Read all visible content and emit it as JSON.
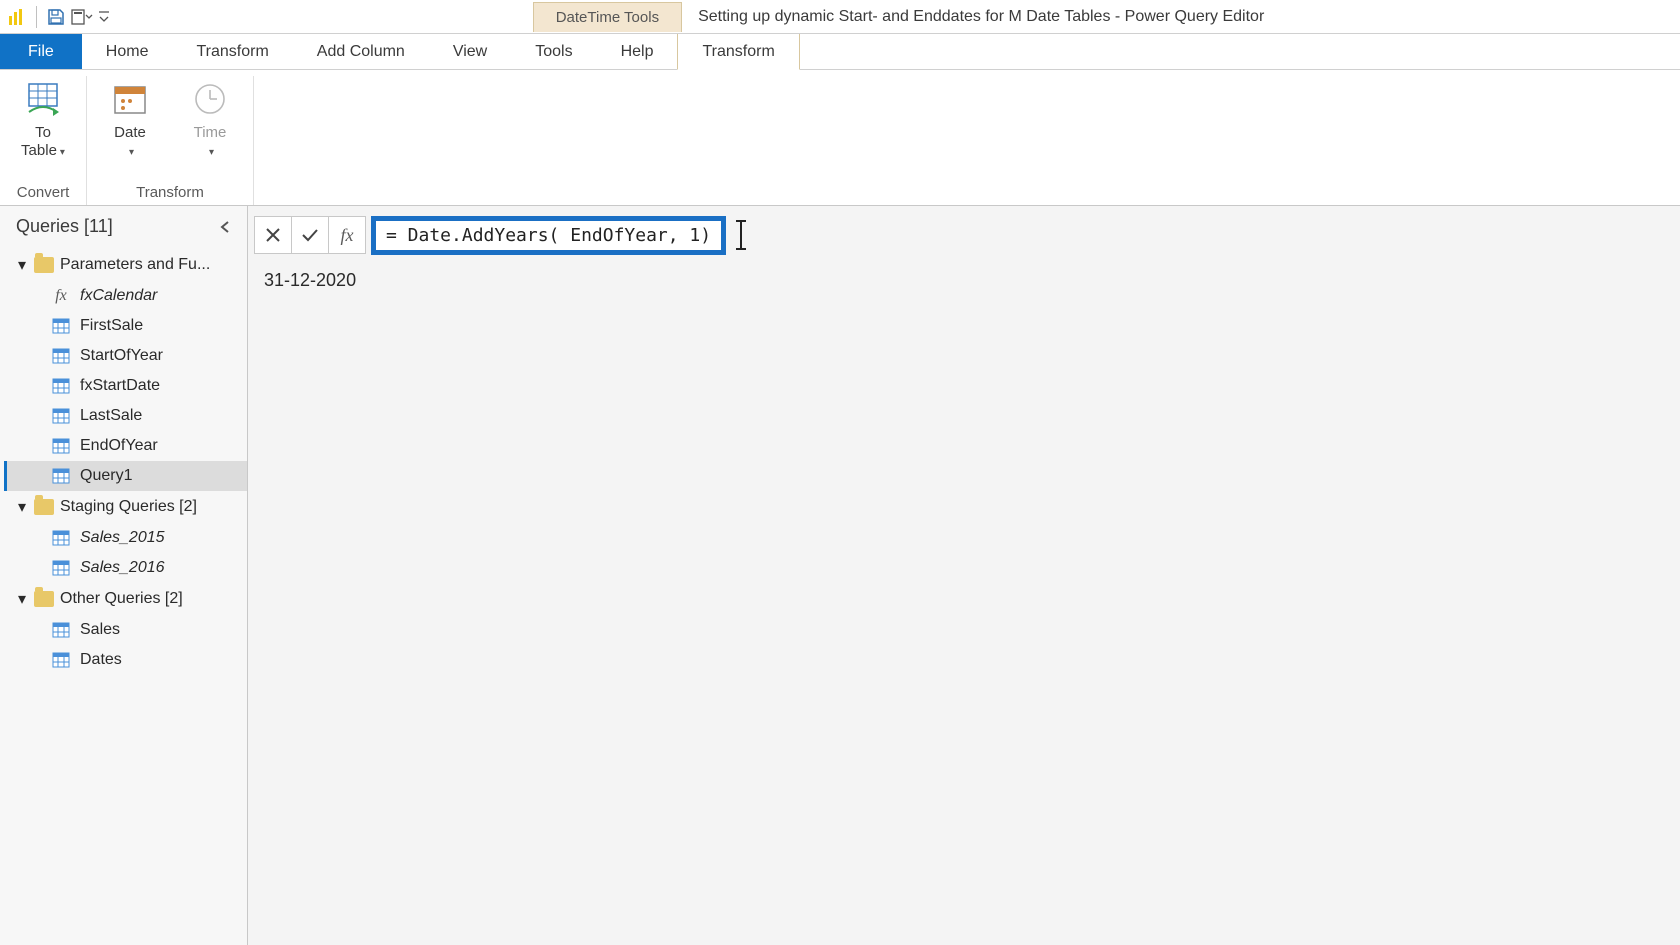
{
  "titlebar": {
    "contextual_label": "DateTime Tools",
    "window_title": "Setting up dynamic Start- and Enddates for M Date Tables - Power Query Editor"
  },
  "tabs": {
    "file": "File",
    "items": [
      "Home",
      "Transform",
      "Add Column",
      "View",
      "Tools",
      "Help"
    ],
    "contextual": "Transform"
  },
  "ribbon": {
    "groups": [
      {
        "label": "Convert",
        "buttons": [
          {
            "label": "To\nTable",
            "icon": "to-table",
            "dropdown": true
          }
        ]
      },
      {
        "label": "Transform",
        "buttons": [
          {
            "label": "Date",
            "icon": "date",
            "dropdown": true
          },
          {
            "label": "Time",
            "icon": "time",
            "dropdown": true,
            "disabled": true
          }
        ]
      }
    ]
  },
  "sidebar": {
    "title": "Queries [11]",
    "groups": [
      {
        "label": "Parameters and Fu...",
        "items": [
          {
            "label": "fxCalendar",
            "icon": "fx",
            "italic": true
          },
          {
            "label": "FirstSale",
            "icon": "table"
          },
          {
            "label": "StartOfYear",
            "icon": "table"
          },
          {
            "label": "fxStartDate",
            "icon": "table"
          },
          {
            "label": "LastSale",
            "icon": "table"
          },
          {
            "label": "EndOfYear",
            "icon": "table"
          },
          {
            "label": "Query1",
            "icon": "table",
            "selected": true
          }
        ]
      },
      {
        "label": "Staging Queries [2]",
        "items": [
          {
            "label": "Sales_2015",
            "icon": "table",
            "italic": true
          },
          {
            "label": "Sales_2016",
            "icon": "table",
            "italic": true
          }
        ]
      },
      {
        "label": "Other Queries [2]",
        "items": [
          {
            "label": "Sales",
            "icon": "table"
          },
          {
            "label": "Dates",
            "icon": "table"
          }
        ]
      }
    ]
  },
  "formula_bar": {
    "formula": "= Date.AddYears( EndOfYear, 1)"
  },
  "result": {
    "value": "31-12-2020"
  }
}
